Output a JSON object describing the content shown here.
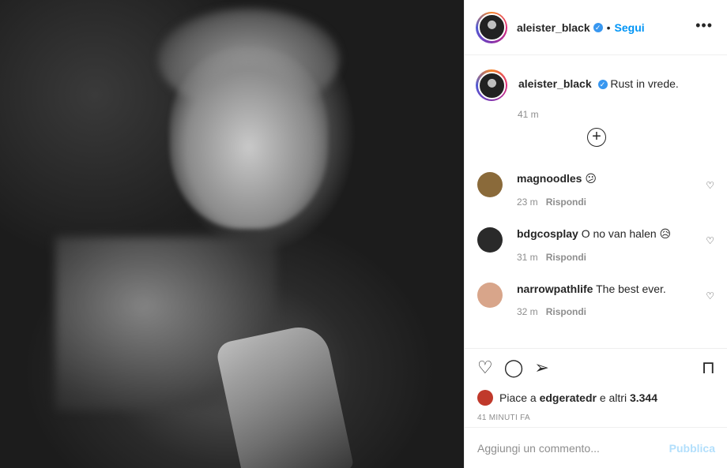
{
  "post": {
    "image_alt": "black-and-white photo of a man holding a guitar",
    "author": "aleister_black",
    "follow_label": "Segui",
    "dot": "•",
    "more": "•••"
  },
  "caption": {
    "user": "aleister_black",
    "text": "Rust in vrede.",
    "time": "41 m"
  },
  "load_more": "+",
  "comments": [
    {
      "user": "magnoodles",
      "text": "😕",
      "time": "23 m",
      "reply": "Rispondi",
      "avatar_color": "#8a6a3a"
    },
    {
      "user": "bdgcosplay",
      "text": "O no van halen 😥",
      "time": "31 m",
      "reply": "Rispondi",
      "avatar_color": "#2a2a2a"
    },
    {
      "user": "narrowpathlife",
      "text": "The best ever.",
      "time": "32 m",
      "reply": "Rispondi",
      "avatar_color": "#d8a58a"
    }
  ],
  "likes": {
    "prefix": "Piace a",
    "first_user": "edgeratedr",
    "suffix": "e altri",
    "count": "3.344"
  },
  "ago": "41 MINUTI FA",
  "add_comment": {
    "placeholder": "Aggiungi un commento...",
    "publish": "Pubblica"
  }
}
